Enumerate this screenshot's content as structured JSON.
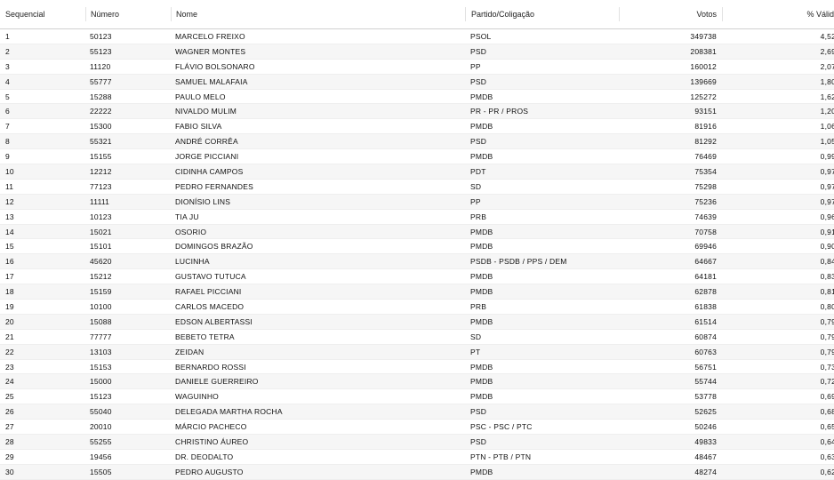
{
  "table": {
    "headers": {
      "sequencial": "Sequencial",
      "numero": "Número",
      "nome": "Nome",
      "partido": "Partido/Coligação",
      "votos": "Votos",
      "pct": "% Válid"
    },
    "rows": [
      {
        "seq": "1",
        "numero": "50123",
        "nome": "MARCELO FREIXO",
        "partido": "PSOL",
        "votos": "349738",
        "pct": "4,52"
      },
      {
        "seq": "2",
        "numero": "55123",
        "nome": "WAGNER MONTES",
        "partido": "PSD",
        "votos": "208381",
        "pct": "2,69"
      },
      {
        "seq": "3",
        "numero": "11120",
        "nome": "FLÁVIO BOLSONARO",
        "partido": "PP",
        "votos": "160012",
        "pct": "2,07"
      },
      {
        "seq": "4",
        "numero": "55777",
        "nome": "SAMUEL MALAFAIA",
        "partido": "PSD",
        "votos": "139669",
        "pct": "1,80"
      },
      {
        "seq": "5",
        "numero": "15288",
        "nome": "PAULO MELO",
        "partido": "PMDB",
        "votos": "125272",
        "pct": "1,62"
      },
      {
        "seq": "6",
        "numero": "22222",
        "nome": "NIVALDO MULIM",
        "partido": "PR - PR / PROS",
        "votos": "93151",
        "pct": "1,20"
      },
      {
        "seq": "7",
        "numero": "15300",
        "nome": "FABIO SILVA",
        "partido": "PMDB",
        "votos": "81916",
        "pct": "1,06"
      },
      {
        "seq": "8",
        "numero": "55321",
        "nome": "ANDRÉ CORRÊA",
        "partido": "PSD",
        "votos": "81292",
        "pct": "1,05"
      },
      {
        "seq": "9",
        "numero": "15155",
        "nome": "JORGE PICCIANI",
        "partido": "PMDB",
        "votos": "76469",
        "pct": "0,99"
      },
      {
        "seq": "10",
        "numero": "12212",
        "nome": "CIDINHA CAMPOS",
        "partido": "PDT",
        "votos": "75354",
        "pct": "0,97"
      },
      {
        "seq": "11",
        "numero": "77123",
        "nome": "PEDRO FERNANDES",
        "partido": "SD",
        "votos": "75298",
        "pct": "0,97"
      },
      {
        "seq": "12",
        "numero": "11111",
        "nome": "DIONÍSIO LINS",
        "partido": "PP",
        "votos": "75236",
        "pct": "0,97"
      },
      {
        "seq": "13",
        "numero": "10123",
        "nome": "TIA JU",
        "partido": "PRB",
        "votos": "74639",
        "pct": "0,96"
      },
      {
        "seq": "14",
        "numero": "15021",
        "nome": "OSORIO",
        "partido": "PMDB",
        "votos": "70758",
        "pct": "0,91"
      },
      {
        "seq": "15",
        "numero": "15101",
        "nome": "DOMINGOS BRAZÃO",
        "partido": "PMDB",
        "votos": "69946",
        "pct": "0,90"
      },
      {
        "seq": "16",
        "numero": "45620",
        "nome": "LUCINHA",
        "partido": "PSDB - PSDB / PPS / DEM",
        "votos": "64667",
        "pct": "0,84"
      },
      {
        "seq": "17",
        "numero": "15212",
        "nome": "GUSTAVO TUTUCA",
        "partido": "PMDB",
        "votos": "64181",
        "pct": "0,83"
      },
      {
        "seq": "18",
        "numero": "15159",
        "nome": "RAFAEL PICCIANI",
        "partido": "PMDB",
        "votos": "62878",
        "pct": "0,81"
      },
      {
        "seq": "19",
        "numero": "10100",
        "nome": "CARLOS MACEDO",
        "partido": "PRB",
        "votos": "61838",
        "pct": "0,80"
      },
      {
        "seq": "20",
        "numero": "15088",
        "nome": "EDSON ALBERTASSI",
        "partido": "PMDB",
        "votos": "61514",
        "pct": "0,79"
      },
      {
        "seq": "21",
        "numero": "77777",
        "nome": "BEBETO TETRA",
        "partido": "SD",
        "votos": "60874",
        "pct": "0,79"
      },
      {
        "seq": "22",
        "numero": "13103",
        "nome": "ZEIDAN",
        "partido": "PT",
        "votos": "60763",
        "pct": "0,79"
      },
      {
        "seq": "23",
        "numero": "15153",
        "nome": "BERNARDO ROSSI",
        "partido": "PMDB",
        "votos": "56751",
        "pct": "0,73"
      },
      {
        "seq": "24",
        "numero": "15000",
        "nome": "DANIELE GUERREIRO",
        "partido": "PMDB",
        "votos": "55744",
        "pct": "0,72"
      },
      {
        "seq": "25",
        "numero": "15123",
        "nome": "WAGUINHO",
        "partido": "PMDB",
        "votos": "53778",
        "pct": "0,69"
      },
      {
        "seq": "26",
        "numero": "55040",
        "nome": "DELEGADA MARTHA ROCHA",
        "partido": "PSD",
        "votos": "52625",
        "pct": "0,68"
      },
      {
        "seq": "27",
        "numero": "20010",
        "nome": "MÁRCIO PACHECO",
        "partido": "PSC - PSC / PTC",
        "votos": "50246",
        "pct": "0,65"
      },
      {
        "seq": "28",
        "numero": "55255",
        "nome": "CHRISTINO ÁUREO",
        "partido": "PSD",
        "votos": "49833",
        "pct": "0,64"
      },
      {
        "seq": "29",
        "numero": "19456",
        "nome": "DR. DEODALTO",
        "partido": "PTN - PTB / PTN",
        "votos": "48467",
        "pct": "0,63"
      },
      {
        "seq": "30",
        "numero": "15505",
        "nome": "PEDRO AUGUSTO",
        "partido": "PMDB",
        "votos": "48274",
        "pct": "0,62"
      }
    ]
  }
}
